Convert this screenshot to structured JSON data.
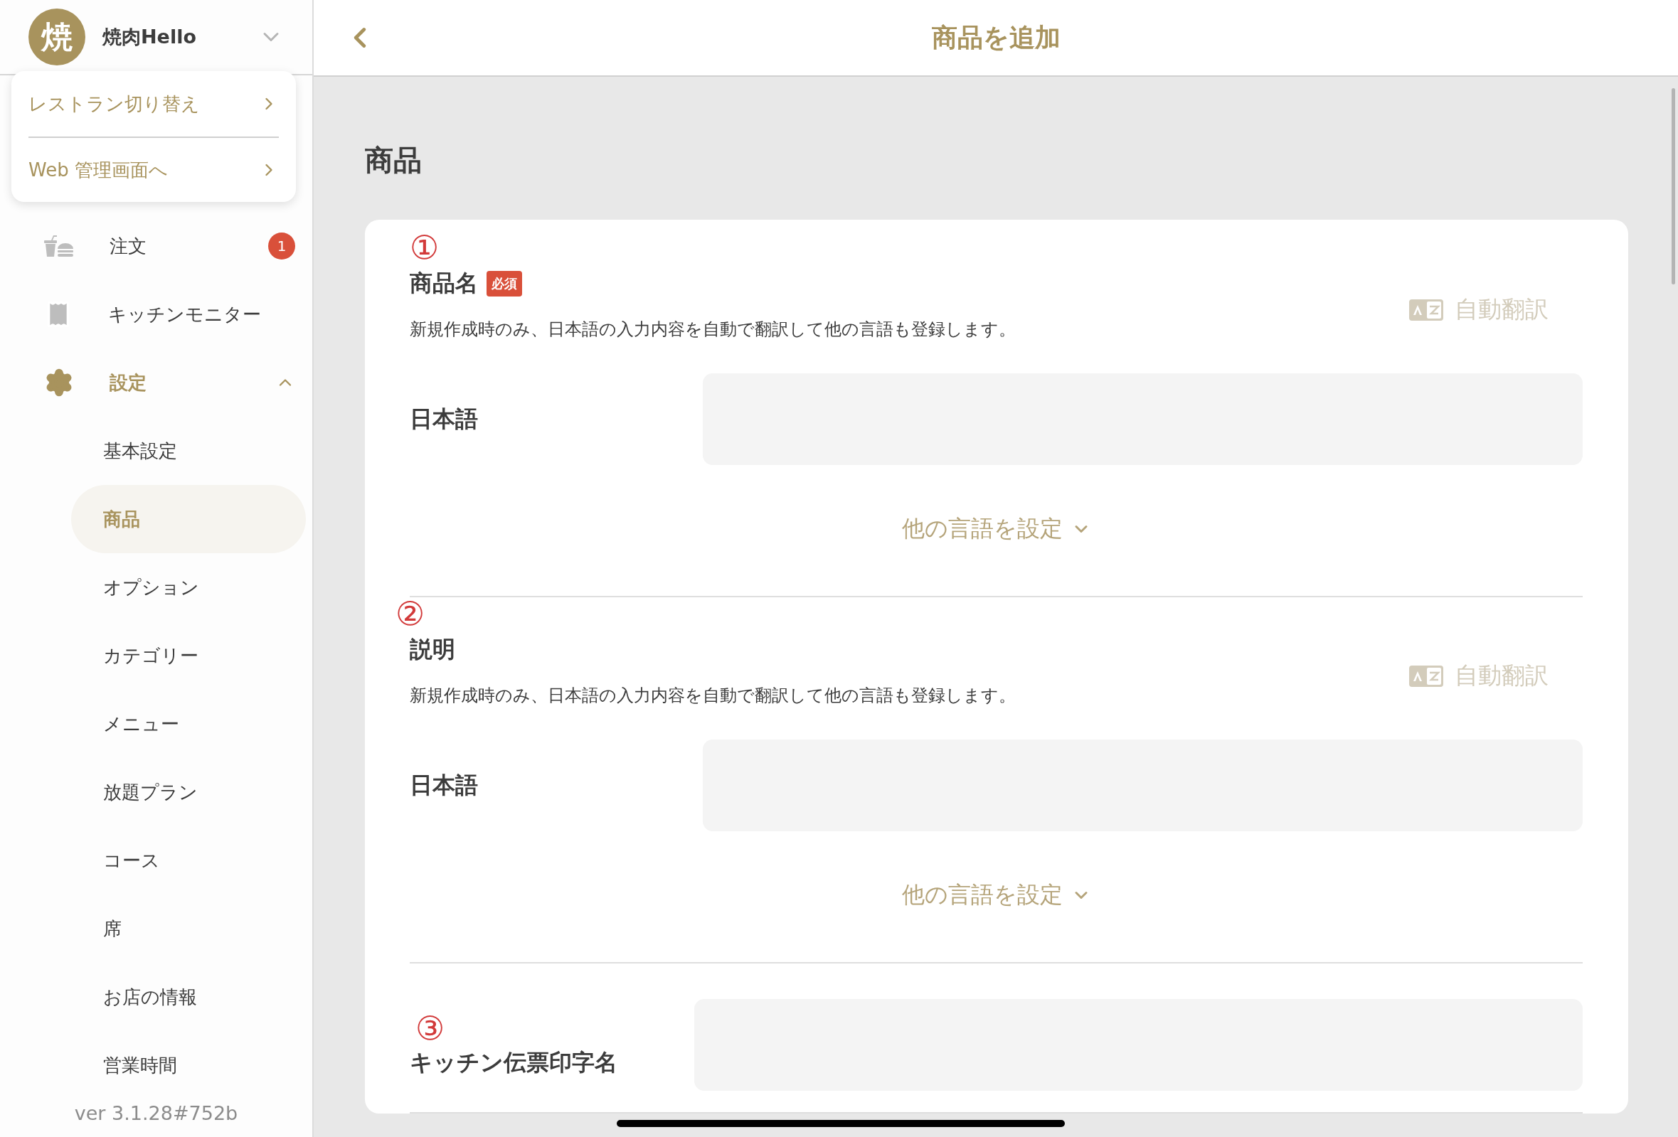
{
  "header": {
    "avatar": "焼",
    "restaurant": "焼肉Hello"
  },
  "menu_popup": [
    {
      "label": "レストラン切り替え"
    },
    {
      "label": "Web 管理画面へ"
    }
  ],
  "nav": [
    {
      "kind": "order",
      "label": "注文",
      "badge": "1"
    },
    {
      "kind": "kitchen",
      "label": "キッチンモニター"
    },
    {
      "kind": "settings",
      "label": "設定",
      "expanded": true,
      "children": [
        {
          "label": "基本設定",
          "selected": false
        },
        {
          "label": "商品",
          "selected": true
        },
        {
          "label": "オプション",
          "selected": false
        },
        {
          "label": "カテゴリー",
          "selected": false
        },
        {
          "label": "メニュー",
          "selected": false
        },
        {
          "label": "放題プラン",
          "selected": false
        },
        {
          "label": "コース",
          "selected": false
        },
        {
          "label": "席",
          "selected": false
        },
        {
          "label": "お店の情報",
          "selected": false
        },
        {
          "label": "営業時間",
          "selected": false
        }
      ]
    }
  ],
  "version": "ver 3.1.28#752b",
  "topbar": {
    "title": "商品を追加"
  },
  "section_title": "商品",
  "fields": [
    {
      "kind": "translatable",
      "marker": "①",
      "label": "商品名",
      "badge": "必須",
      "auto_translate": "自動翻訳",
      "note": "新規作成時のみ、日本語の入力内容を自動で翻訳して他の言語も登録します。",
      "language": "日本語",
      "other_languages": "他の言語を設定"
    },
    {
      "kind": "translatable",
      "marker": "②",
      "label": "説明",
      "auto_translate": "自動翻訳",
      "note": "新規作成時のみ、日本語の入力内容を自動で翻訳して他の言語も登録します。",
      "language": "日本語",
      "other_languages": "他の言語を設定"
    },
    {
      "kind": "single",
      "marker": "③",
      "label": "キッチン伝票印字名"
    }
  ]
}
